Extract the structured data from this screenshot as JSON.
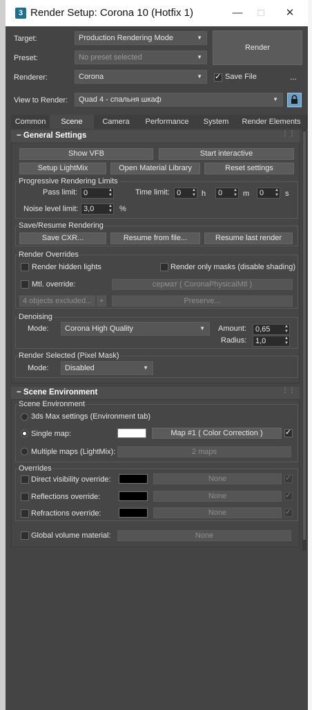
{
  "window": {
    "title": "Render Setup: Corona 10 (Hotfix 1)",
    "icon": "3"
  },
  "top": {
    "target_label": "Target:",
    "target_value": "Production Rendering Mode",
    "preset_label": "Preset:",
    "preset_value": "No preset selected",
    "renderer_label": "Renderer:",
    "renderer_value": "Corona",
    "render_button": "Render",
    "save_file_label": "Save File",
    "more": "...",
    "view_label": "View to Render:",
    "view_value": "Quad 4 - спальня шкаф"
  },
  "tabs": [
    "Common",
    "Scene",
    "Camera",
    "Performance",
    "System",
    "Render Elements"
  ],
  "general": {
    "title": "General Settings",
    "show_vfb": "Show VFB",
    "start_interactive": "Start interactive",
    "setup_lightmix": "Setup LightMix",
    "open_material_library": "Open Material Library",
    "reset_settings": "Reset settings",
    "prog_title": "Progressive Rendering Limits",
    "pass_limit_label": "Pass limit:",
    "pass_limit": "0",
    "time_limit_label": "Time limit:",
    "h_val": "0",
    "h": "h",
    "m_val": "0",
    "m": "m",
    "s_val": "0",
    "s": "s",
    "noise_label": "Noise level limit:",
    "noise": "3,0",
    "pct": "%",
    "save_title": "Save/Resume Rendering",
    "save_cxr": "Save CXR...",
    "resume_file": "Resume from file...",
    "resume_last": "Resume last render",
    "overrides_title": "Render Overrides",
    "hidden_lights": "Render hidden lights",
    "only_masks": "Render only masks (disable shading)",
    "mtl_override": "Mtl. override:",
    "mtl_value": "сермат  ( CoronaPhysicalMtl )",
    "excluded": "4 objects excluded...",
    "plus": "+",
    "preserve": "Preserve...",
    "denoise_title": "Denoising",
    "mode_label": "Mode:",
    "denoise_mode": "Corona High Quality",
    "amount_label": "Amount:",
    "amount": "0,65",
    "radius_label": "Radius:",
    "radius": "1,0",
    "pixel_title": "Render Selected (Pixel Mask)",
    "pixel_mode_label": "Mode:",
    "pixel_mode": "Disabled"
  },
  "scene_env": {
    "title": "Scene Environment",
    "group_title": "Scene Environment",
    "max_settings": "3ds Max settings (Environment tab)",
    "single_map": "Single map:",
    "single_map_value": "Map #1  ( Color Correction )",
    "multiple_maps": "Multiple maps (LightMix):",
    "multiple_value": "2 maps",
    "overrides_title": "Overrides",
    "direct": "Direct visibility override:",
    "reflections": "Reflections override:",
    "refractions": "Refractions override:",
    "none": "None",
    "global_volume": "Global volume material:",
    "global_none": "None"
  },
  "colors": {
    "window_bg": "#444444",
    "swatch_white": "#ffffff",
    "swatch_black": "#000000"
  }
}
